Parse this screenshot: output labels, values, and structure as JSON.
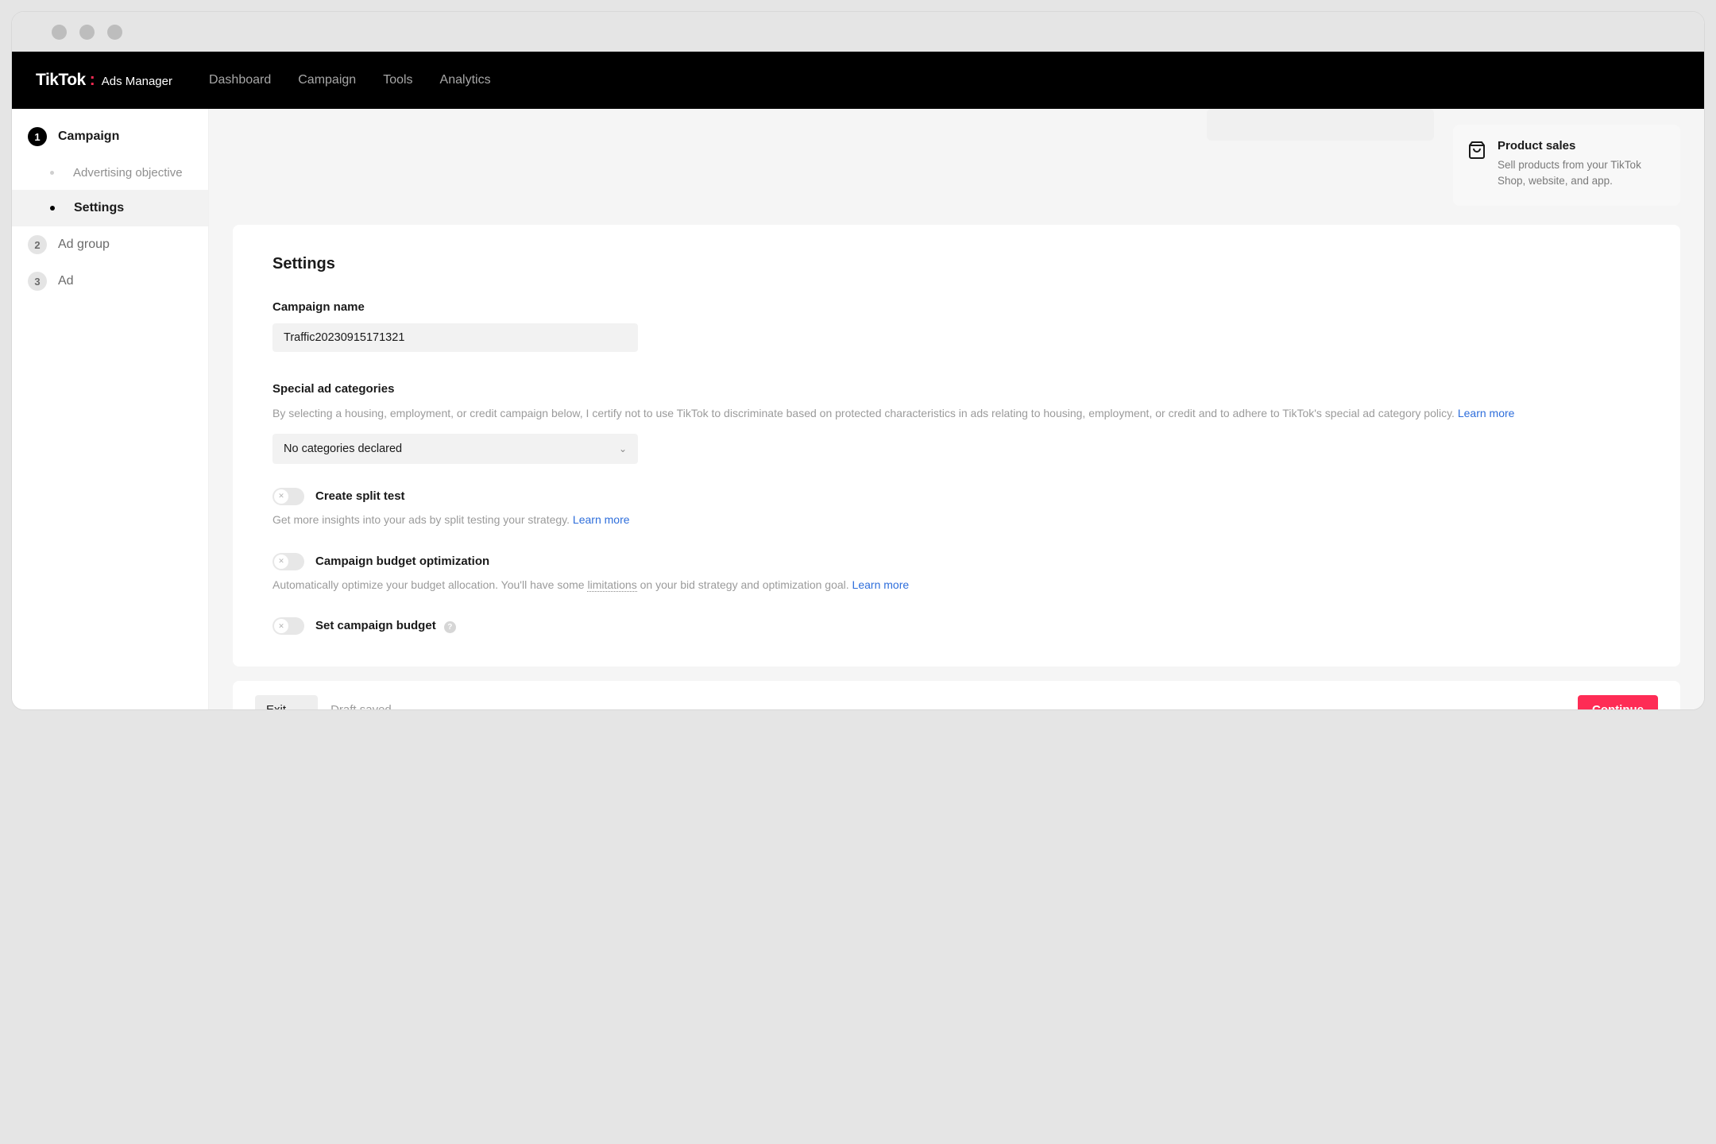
{
  "brand": {
    "name": "TikTok",
    "suffix": "Ads Manager"
  },
  "nav": {
    "items": [
      "Dashboard",
      "Campaign",
      "Tools",
      "Analytics"
    ]
  },
  "sidebar": {
    "step1": {
      "num": "1",
      "label": "Campaign"
    },
    "step1_subs": [
      "Advertising objective",
      "Settings"
    ],
    "step2": {
      "num": "2",
      "label": "Ad group"
    },
    "step3": {
      "num": "3",
      "label": "Ad"
    }
  },
  "product_card": {
    "title": "Product sales",
    "desc": "Sell products from your TikTok Shop, website, and app."
  },
  "settings": {
    "heading": "Settings",
    "campaign_name_label": "Campaign name",
    "campaign_name_value": "Traffic20230915171321",
    "special_cat_label": "Special ad categories",
    "special_cat_help": "By selecting a housing, employment, or credit campaign below, I certify not to use TikTok to discriminate based on protected characteristics in ads relating to housing, employment, or credit and to adhere to TikTok's special ad category policy.  ",
    "no_categories": "No categories declared",
    "split_test_label": "Create split test",
    "split_test_help": "Get more insights into your ads by split testing your strategy.  ",
    "cbo_label": "Campaign budget optimization",
    "cbo_help_1": "Automatically optimize your budget allocation. You'll have some ",
    "cbo_help_2": "limitations",
    "cbo_help_3": " on your bid strategy and optimization goal. ",
    "campaign_budget_label": "Set campaign budget",
    "learn_more": "Learn more"
  },
  "footer": {
    "exit": "Exit",
    "draft": "Draft saved",
    "continue": "Continue"
  }
}
